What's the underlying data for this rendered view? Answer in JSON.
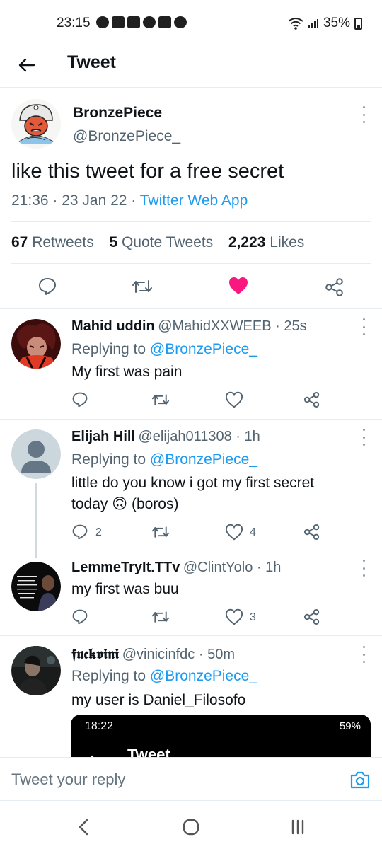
{
  "status_bar": {
    "time": "23:15",
    "battery": "35%"
  },
  "header": {
    "title": "Tweet"
  },
  "main_tweet": {
    "name": "BronzePiece",
    "handle": "@BronzePiece_",
    "text": "like this tweet for a free secret",
    "time_date": "21:36 · 23 Jan 22 · ",
    "source": "Twitter Web App",
    "stats": {
      "retweets_count": "67",
      "retweets_label": "Retweets",
      "quotes_count": "5",
      "quotes_label": "Quote Tweets",
      "likes_count": "2,223",
      "likes_label": "Likes"
    },
    "liked": true,
    "like_color": "#f91880"
  },
  "replies": [
    {
      "name": "Mahid uddin",
      "handle": "@MahidXXWEEB · 25s",
      "replying_prefix": "Replying to ",
      "replying_to": "@BronzePiece_",
      "text": "My first was pain",
      "reply_count": "",
      "like_count": ""
    },
    {
      "name": "Elijah Hill",
      "handle": "@elijah011308 · 1h",
      "replying_prefix": "Replying to ",
      "replying_to": "@BronzePiece_",
      "text_line1": "little do you know i got my first secret",
      "text_line2_a": "today ",
      "emoji": "🙃",
      "text_line2_b": " (boros)",
      "reply_count": "2",
      "like_count": "4"
    },
    {
      "name": "LemmeTryIt.TTv",
      "handle": "@ClintYolo · 1h",
      "text": "my first was buu",
      "like_count": "3"
    },
    {
      "name": "𝖋𝖚𝖈𝖐𝖛𝖎𝖓𝖎",
      "handle": "@vinicinfdc · 50m",
      "replying_prefix": "Replying to ",
      "replying_to": "@BronzePiece_",
      "text": "my user is Daniel_Filosofo",
      "embed": {
        "time": "18:22",
        "battery": "59%",
        "title": "Tweet"
      }
    }
  ],
  "compose": {
    "placeholder": "Tweet your reply"
  },
  "colors": {
    "accent": "#1d9bf0",
    "secondary_text": "#536471",
    "divider": "#e6ecf0"
  },
  "icons": [
    "back-arrow-icon",
    "more-icon",
    "reply-icon",
    "retweet-icon",
    "heart-icon",
    "share-icon",
    "camera-icon",
    "nav-back-icon",
    "nav-home-icon",
    "nav-recents-icon"
  ]
}
